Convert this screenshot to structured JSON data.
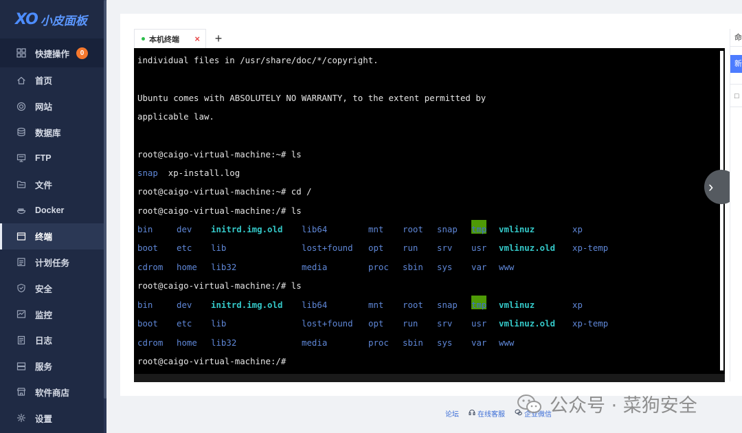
{
  "brand": {
    "mark": "XO",
    "name": "小皮面板"
  },
  "sidebar": {
    "quick": {
      "label": "快捷操作",
      "badge": "0"
    },
    "items": [
      {
        "label": "首页",
        "icon": "home-icon"
      },
      {
        "label": "网站",
        "icon": "globe-icon"
      },
      {
        "label": "数据库",
        "icon": "database-icon"
      },
      {
        "label": "FTP",
        "icon": "monitor-icon"
      },
      {
        "label": "文件",
        "icon": "folder-icon"
      },
      {
        "label": "Docker",
        "icon": "docker-icon"
      },
      {
        "label": "终端",
        "icon": "terminal-icon",
        "active": true
      },
      {
        "label": "计划任务",
        "icon": "calendar-icon"
      },
      {
        "label": "安全",
        "icon": "shield-icon"
      },
      {
        "label": "监控",
        "icon": "chart-icon"
      },
      {
        "label": "日志",
        "icon": "log-icon"
      },
      {
        "label": "服务",
        "icon": "server-icon"
      },
      {
        "label": "软件商店",
        "icon": "store-icon"
      },
      {
        "label": "设置",
        "icon": "gear-icon"
      }
    ]
  },
  "tabs": [
    {
      "label": "本机终端",
      "status": "connected"
    }
  ],
  "add_tab_label": "+",
  "terminal": {
    "prompt_home": "root@caigo-virtual-machine:~# ",
    "prompt_root": "root@caigo-virtual-machine:/# ",
    "lines": [
      "individual files in /usr/share/doc/*/copyright.",
      "",
      "Ubuntu comes with ABSOLUTELY NO WARRANTY, to the extent permitted by",
      "applicable law.",
      ""
    ],
    "home_ls_cmd": "ls",
    "home_ls_snap": "snap",
    "home_ls_log": "xp-install.log",
    "cd_cmd": "cd /",
    "ls_cmd": "ls",
    "ls_rows": [
      [
        "bin",
        "dev",
        "initrd.img.old",
        "lib64",
        "mnt",
        "root",
        "snap",
        "tmp",
        "vmlinuz",
        "xp"
      ],
      [
        "boot",
        "etc",
        "lib",
        "lost+found",
        "opt",
        "run",
        "srv",
        "usr",
        "vmlinuz.old",
        "xp-temp"
      ],
      [
        "cdrom",
        "home",
        "lib32",
        "media",
        "proc",
        "sbin",
        "sys",
        "var",
        "www"
      ]
    ]
  },
  "right_panel": {
    "tab_label": "命",
    "button_label": "新",
    "row_label": "□"
  },
  "footer": [
    {
      "label": "论坛",
      "icon": ""
    },
    {
      "label": "在线客服",
      "icon": "headset-icon"
    },
    {
      "label": "企业微信",
      "icon": "chat-icon"
    }
  ],
  "watermark": {
    "text": "公众号 · 菜狗安全"
  },
  "colors": {
    "sidebar_bg": "#1f2a44",
    "accent": "#4d7cff",
    "terminal_bg": "#000000",
    "dir": "#5f87d7",
    "tmp_bg": "#4e9a06"
  }
}
